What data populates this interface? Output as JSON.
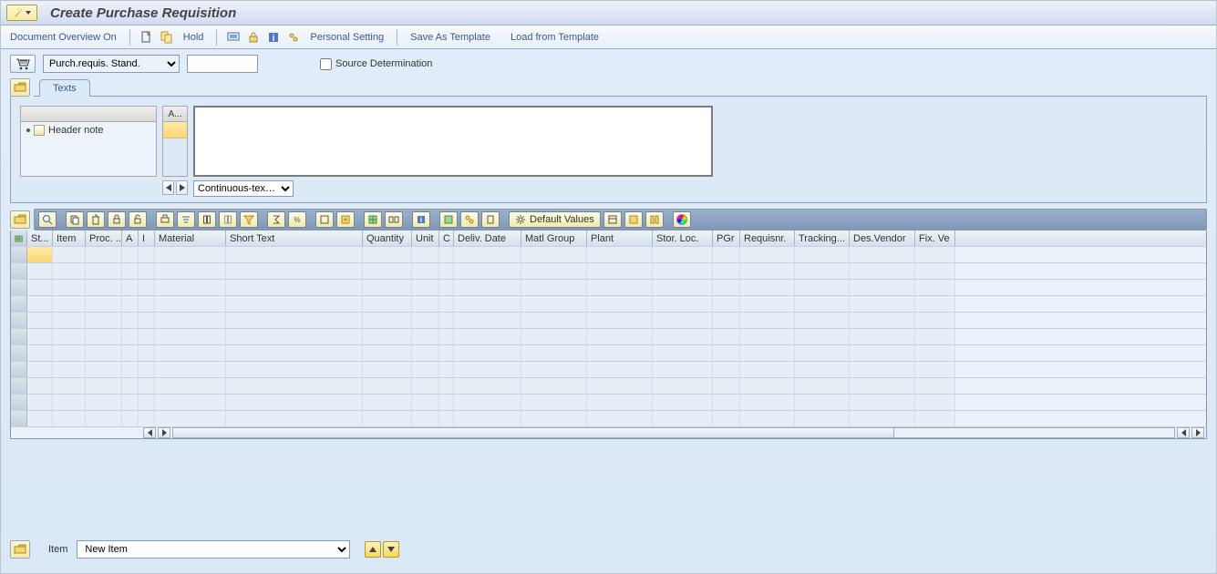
{
  "title": "Create Purchase Requisition",
  "apptoolbar": {
    "doc_overview": "Document Overview On",
    "hold": "Hold",
    "personal_setting": "Personal Setting",
    "save_template": "Save As Template",
    "load_template": "Load from Template"
  },
  "doctype": {
    "type": "Purch.requis. Stand.",
    "number": "",
    "source_determination_label": "Source Determination",
    "source_determination_checked": false
  },
  "texts_tab": {
    "label": "Texts",
    "a_header": "A...",
    "tree_item": "Header note",
    "editor_value": "",
    "continuous_text": "Continuous-tex…"
  },
  "grid_toolbar": {
    "default_values": "Default Values"
  },
  "grid_columns": [
    "St...",
    "Item",
    "Proc. ...",
    "A",
    "I",
    "Material",
    "Short Text",
    "Quantity",
    "Unit",
    "C",
    "Deliv. Date",
    "Matl Group",
    "Plant",
    "Stor. Loc.",
    "PGr",
    "Requisnr.",
    "Tracking...",
    "Des.Vendor",
    "Fix. Ve"
  ],
  "item_bar": {
    "label": "Item",
    "value": "New Item"
  }
}
